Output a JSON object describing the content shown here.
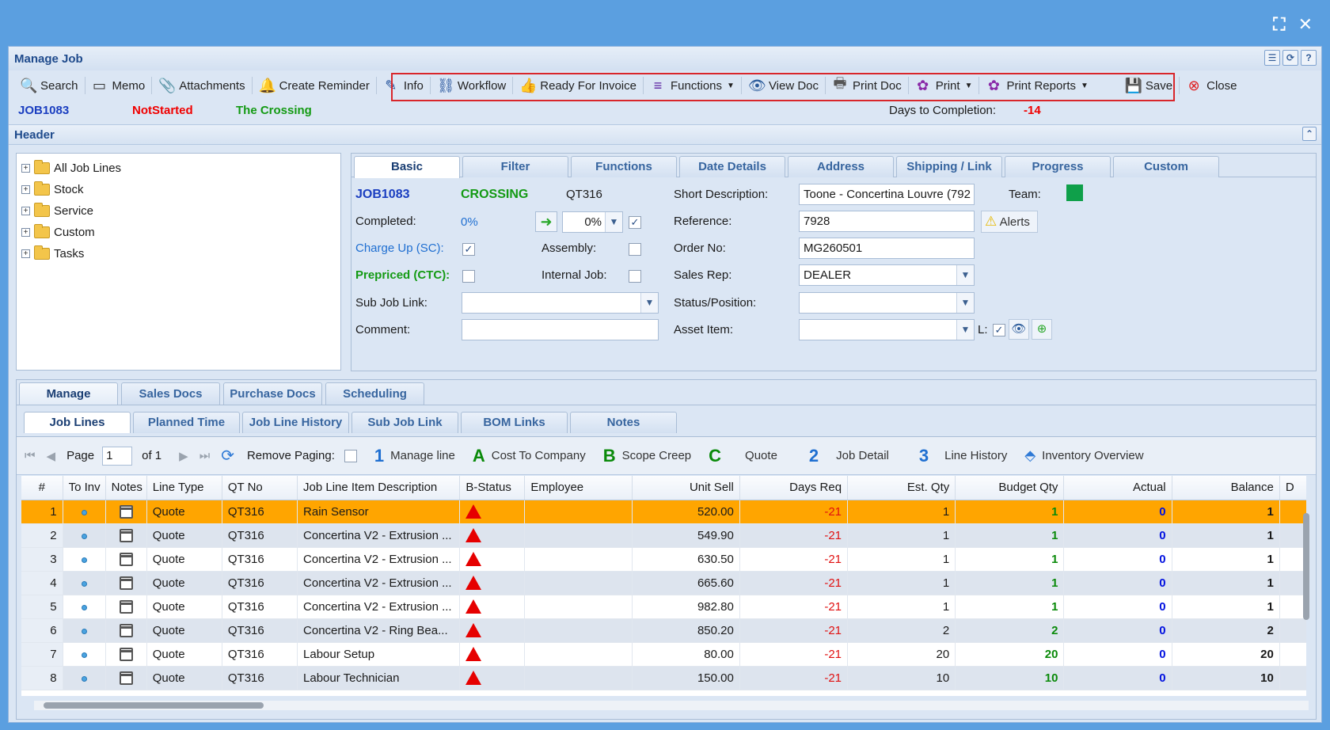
{
  "window": {
    "title": "Manage Job"
  },
  "toolbar": {
    "items": [
      {
        "label": "Search",
        "icon": "search-icon"
      },
      {
        "label": "Memo",
        "icon": "memo-icon"
      },
      {
        "label": "Attachments",
        "icon": "paperclip-icon"
      },
      {
        "label": "Create Reminder",
        "icon": "bell-icon"
      },
      {
        "label": "Info",
        "icon": "edit-icon"
      },
      {
        "label": "Workflow",
        "icon": "workflow-icon"
      },
      {
        "label": "Ready For Invoice",
        "icon": "thumbs-up-icon"
      },
      {
        "label": "Functions",
        "icon": "menu-icon"
      },
      {
        "label": "View Doc",
        "icon": "eye-icon"
      },
      {
        "label": "Print Doc",
        "icon": "printer-icon"
      },
      {
        "label": "Print",
        "icon": "print-icon"
      },
      {
        "label": "Print Reports",
        "icon": "print-reports-icon"
      },
      {
        "label": "Save",
        "icon": "save-icon"
      },
      {
        "label": "Close",
        "icon": "close-icon"
      }
    ]
  },
  "status": {
    "job": "JOB1083",
    "state": "NotStarted",
    "site": "The Crossing",
    "days_label": "Days to Completion:",
    "days_value": "-14"
  },
  "header": {
    "title": "Header"
  },
  "tree": [
    "All Job Lines",
    "Stock",
    "Service",
    "Custom",
    "Tasks"
  ],
  "form_tabs": [
    "Basic",
    "Filter",
    "Functions",
    "Date Details",
    "Address",
    "Shipping / Link",
    "Progress",
    "Custom"
  ],
  "form": {
    "job_no": "JOB1083",
    "crossing": "CROSSING",
    "quote_no": "QT316",
    "completed_label": "Completed:",
    "completed_value": "0%",
    "completed_select": "0%",
    "charge_up_label": "Charge Up (SC):",
    "assembly_label": "Assembly:",
    "prepriced_label": "Prepriced (CTC):",
    "internal_label": "Internal Job:",
    "subjob_label": "Sub Job Link:",
    "comment_label": "Comment:",
    "short_desc_label": "Short Description:",
    "short_desc_value": "Toone - Concertina Louvre (792",
    "team_label": "Team:",
    "reference_label": "Reference:",
    "reference_value": "7928",
    "alerts_label": "Alerts",
    "order_label": "Order No:",
    "order_value": "MG260501",
    "sales_rep_label": "Sales Rep:",
    "sales_rep_value": "DEALER",
    "status_label": "Status/Position:",
    "asset_label": "Asset Item:",
    "l_label": "L:"
  },
  "bottom_tabs": [
    "Manage",
    "Sales Docs",
    "Purchase Docs",
    "Scheduling"
  ],
  "inner_tabs": [
    "Job Lines",
    "Planned Time",
    "Job Line History",
    "Sub Job Link",
    "BOM Links",
    "Notes"
  ],
  "grid_toolbar": {
    "page_label": "Page",
    "page_value": "1",
    "of_label": "of 1",
    "remove_paging": "Remove Paging:",
    "shortcuts": [
      {
        "key": "1",
        "label": "Manage line",
        "color": "#1f6fd1"
      },
      {
        "key": "A",
        "label": "Cost To Company",
        "color": "#0a8a0a"
      },
      {
        "key": "B",
        "label": "Scope Creep",
        "color": "#0a8a0a"
      },
      {
        "key": "C",
        "label": "Quote",
        "color": "#0a8a0a"
      },
      {
        "key": "2",
        "label": "Job Detail",
        "color": "#1f6fd1"
      },
      {
        "key": "3",
        "label": "Line History",
        "color": "#1f6fd1"
      }
    ],
    "inventory": "Inventory Overview"
  },
  "grid": {
    "columns": [
      "#",
      "To Inv",
      "Notes",
      "Line Type",
      "QT No",
      "Job Line Item Description",
      "B-Status",
      "Employee",
      "Unit Sell",
      "Days Req",
      "Est. Qty",
      "Budget Qty",
      "Actual",
      "Balance",
      "D"
    ],
    "rows": [
      {
        "n": "1",
        "type": "Quote",
        "qt": "QT316",
        "desc": "Rain Sensor",
        "sell": "520.00",
        "days": "-21",
        "est": "1",
        "budget": "1",
        "actual": "0",
        "balance": "1"
      },
      {
        "n": "2",
        "type": "Quote",
        "qt": "QT316",
        "desc": "Concertina V2 - Extrusion ...",
        "sell": "549.90",
        "days": "-21",
        "est": "1",
        "budget": "1",
        "actual": "0",
        "balance": "1"
      },
      {
        "n": "3",
        "type": "Quote",
        "qt": "QT316",
        "desc": "Concertina V2 - Extrusion ...",
        "sell": "630.50",
        "days": "-21",
        "est": "1",
        "budget": "1",
        "actual": "0",
        "balance": "1"
      },
      {
        "n": "4",
        "type": "Quote",
        "qt": "QT316",
        "desc": "Concertina V2 - Extrusion ...",
        "sell": "665.60",
        "days": "-21",
        "est": "1",
        "budget": "1",
        "actual": "0",
        "balance": "1"
      },
      {
        "n": "5",
        "type": "Quote",
        "qt": "QT316",
        "desc": "Concertina V2 - Extrusion ...",
        "sell": "982.80",
        "days": "-21",
        "est": "1",
        "budget": "1",
        "actual": "0",
        "balance": "1"
      },
      {
        "n": "6",
        "type": "Quote",
        "qt": "QT316",
        "desc": "Concertina V2 - Ring Bea...",
        "sell": "850.20",
        "days": "-21",
        "est": "2",
        "budget": "2",
        "actual": "0",
        "balance": "2"
      },
      {
        "n": "7",
        "type": "Quote",
        "qt": "QT316",
        "desc": "Labour Setup",
        "sell": "80.00",
        "days": "-21",
        "est": "20",
        "budget": "20",
        "actual": "0",
        "balance": "20"
      },
      {
        "n": "8",
        "type": "Quote",
        "qt": "QT316",
        "desc": "Labour Technician",
        "sell": "150.00",
        "days": "-21",
        "est": "10",
        "budget": "10",
        "actual": "0",
        "balance": "10"
      }
    ]
  },
  "colors": {
    "accent": "#1e4a8c",
    "selected_row": "#ffa500",
    "highlight_box": "#d9262b"
  }
}
